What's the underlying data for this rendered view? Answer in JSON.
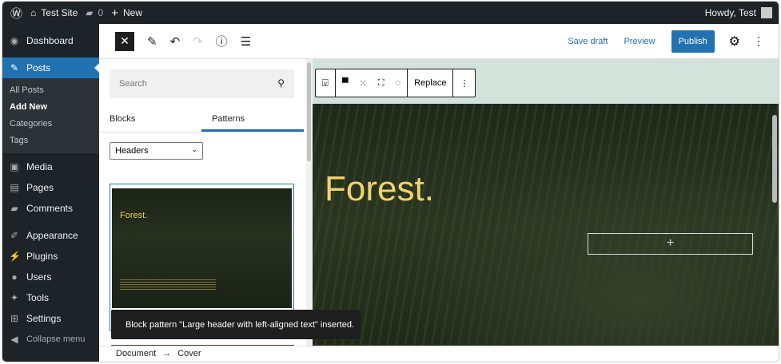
{
  "adminbar": {
    "site": "Test Site",
    "comments": "0",
    "new": "New",
    "howdy": "Howdy, Test"
  },
  "sidebar": {
    "items": [
      {
        "label": "Dashboard",
        "icon": "◉"
      },
      {
        "label": "Posts",
        "icon": "✎"
      },
      {
        "label": "Media",
        "icon": "▣"
      },
      {
        "label": "Pages",
        "icon": "▤"
      },
      {
        "label": "Comments",
        "icon": "▰"
      },
      {
        "label": "Appearance",
        "icon": "✐"
      },
      {
        "label": "Plugins",
        "icon": "⚡"
      },
      {
        "label": "Users",
        "icon": "●"
      },
      {
        "label": "Tools",
        "icon": "✦"
      },
      {
        "label": "Settings",
        "icon": "⊞"
      },
      {
        "label": "Collapse menu",
        "icon": "◀"
      }
    ],
    "sub": [
      "All Posts",
      "Add New",
      "Categories",
      "Tags"
    ]
  },
  "header": {
    "save_draft": "Save draft",
    "preview": "Preview",
    "publish": "Publish"
  },
  "inserter": {
    "search_placeholder": "Search",
    "tabs": [
      "Blocks",
      "Patterns"
    ],
    "category": "Headers",
    "pattern_title": "Forest."
  },
  "block_toolbar": {
    "replace": "Replace"
  },
  "canvas": {
    "title": "Forest.",
    "add": "+"
  },
  "snackbar": "Block pattern \"Large header with left-aligned text\" inserted.",
  "breadcrumb": [
    "Document",
    "Cover"
  ]
}
